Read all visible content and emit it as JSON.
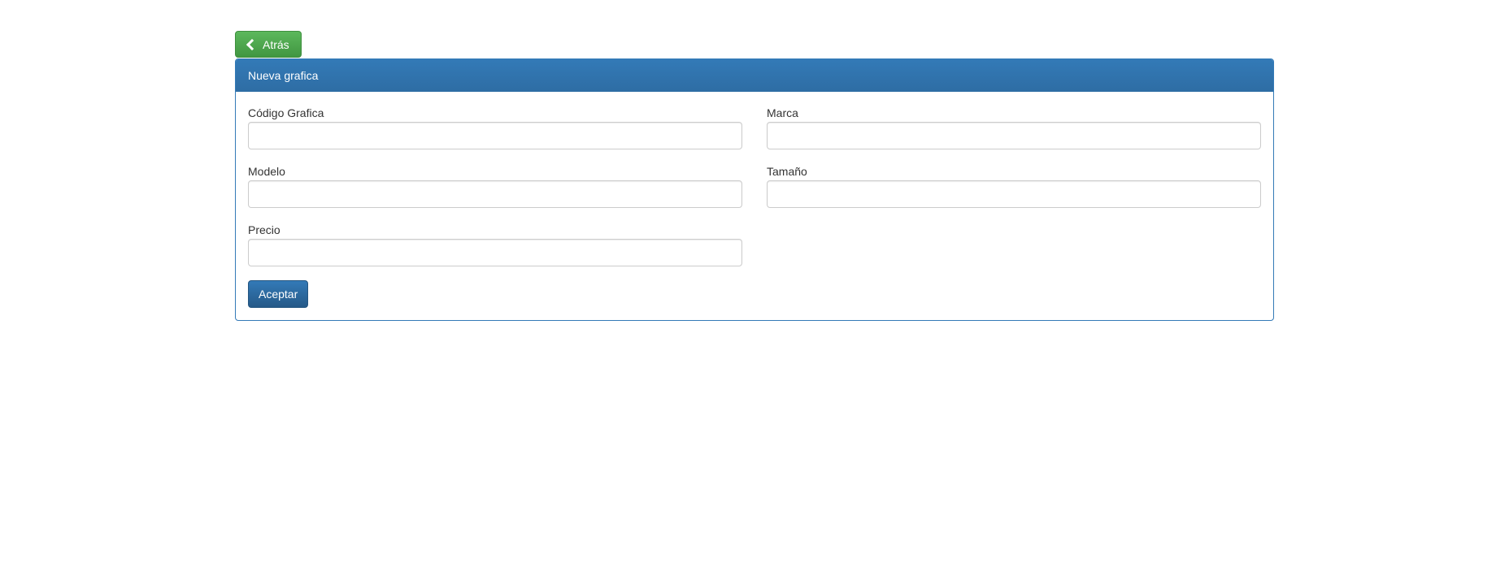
{
  "toolbar": {
    "back_label": "Atrás",
    "back_icon": "chevron-left-icon"
  },
  "panel": {
    "title": "Nueva grafica"
  },
  "form": {
    "fields": [
      {
        "label": "Código Grafica",
        "value": "",
        "placeholder": ""
      },
      {
        "label": "Marca",
        "value": "",
        "placeholder": ""
      },
      {
        "label": "Modelo",
        "value": "",
        "placeholder": ""
      },
      {
        "label": "Tamaño",
        "value": "",
        "placeholder": ""
      },
      {
        "label": "Precio",
        "value": "",
        "placeholder": ""
      }
    ],
    "submit_label": "Aceptar"
  },
  "colors": {
    "back_button": "#5cb85c",
    "primary": "#337ab7"
  }
}
